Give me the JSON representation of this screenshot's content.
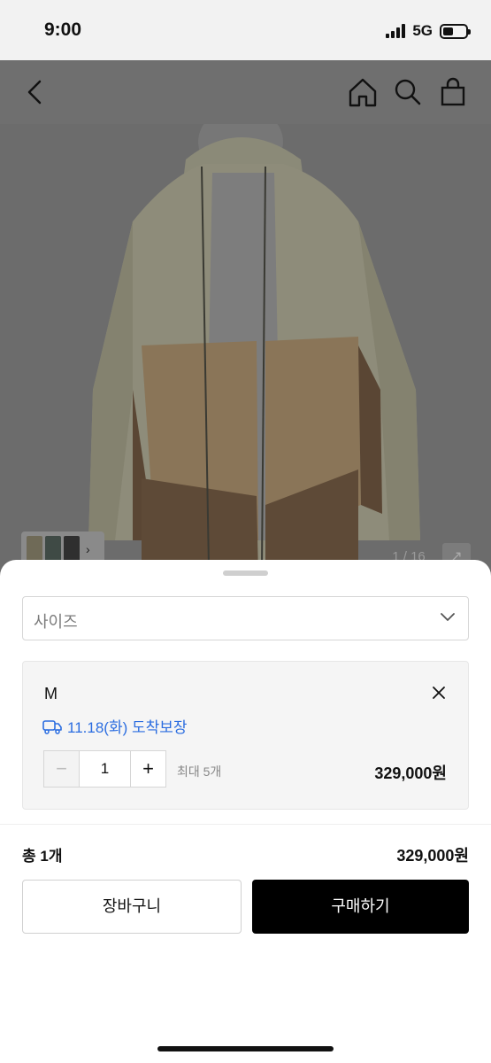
{
  "status_bar": {
    "time": "9:00",
    "network": "5G",
    "battery_level": 0.45
  },
  "gallery": {
    "counter": "1 / 16"
  },
  "sheet": {
    "size_placeholder": "사이즈",
    "selected": {
      "option": "M",
      "delivery": "11.18(화) 도착보장",
      "quantity": "1",
      "max_note": "최대 5개",
      "price": "329,000원"
    },
    "total": {
      "label": "총 1개",
      "price": "329,000원"
    },
    "cart_label": "장바구니",
    "buy_label": "구매하기"
  },
  "colors": {
    "accent_blue": "#2b6de0",
    "buy_button": "#000000",
    "overlay": "#6f6f6f"
  }
}
